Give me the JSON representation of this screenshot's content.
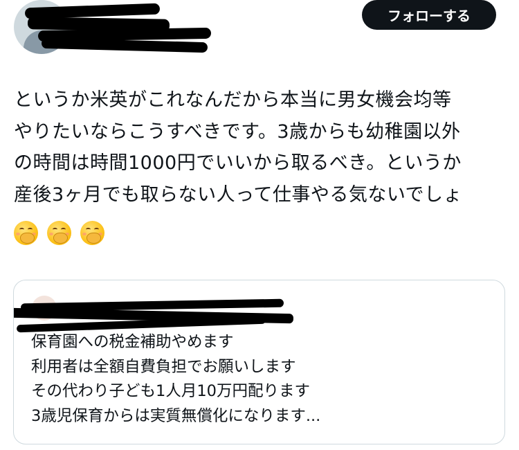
{
  "header": {
    "follow_label": "フォローする"
  },
  "tweet": {
    "lines": [
      "というか米英がこれなんだから本当に男女機会均等",
      "やりたいならこうすべきです。3歳からも幼稚園以外",
      "の時間は時間1000円でいいから取るべき。というか",
      "産後3ヶ月でも取らない人って仕事やる気ないでしょ"
    ],
    "emojis": [
      "face-with-hand-over-mouth-icon",
      "face-with-hand-over-mouth-icon",
      "face-with-hand-over-mouth-icon"
    ]
  },
  "quote": {
    "lines": [
      "保育園への税金補助やめます",
      "利用者は全額自費負担でお願いします",
      "その代わり子ども1人月10万円配ります",
      "3歳児保育からは実質無償化になります..."
    ]
  },
  "colors": {
    "text": "#0f1419",
    "button_bg": "#0f1419",
    "button_text": "#ffffff",
    "border": "#cfd9de",
    "avatar_bg": "#cfd9de"
  }
}
